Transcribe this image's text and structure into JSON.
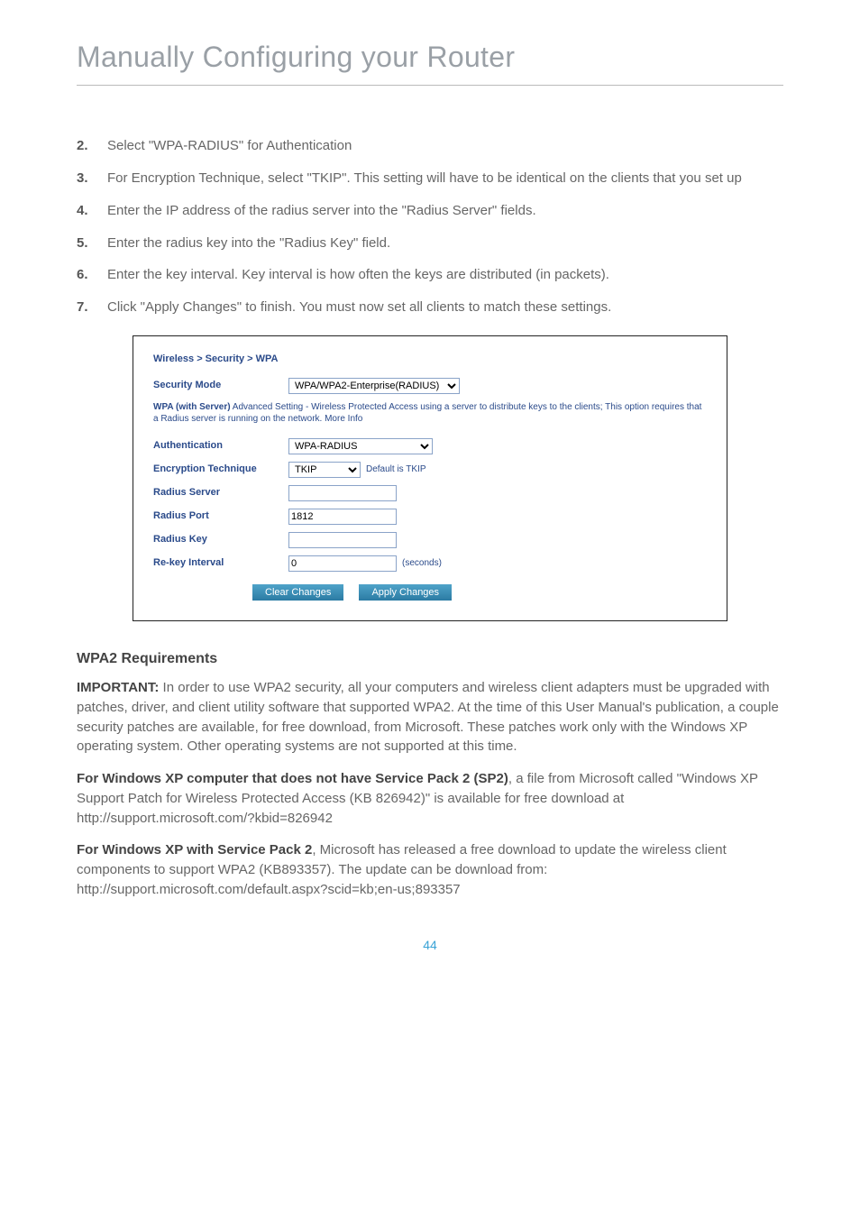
{
  "title": "Manually Configuring your Router",
  "steps": [
    {
      "num": "2.",
      "txt": "Select \"WPA-RADIUS\" for Authentication"
    },
    {
      "num": "3.",
      "txt": "For Encryption Technique, select \"TKIP\". This setting will have to be identical on the clients that you set up"
    },
    {
      "num": "4.",
      "txt": "Enter the IP address of the radius server into the \"Radius Server\" fields."
    },
    {
      "num": "5.",
      "txt": "Enter the radius key into the \"Radius Key\" field."
    },
    {
      "num": "6.",
      "txt": "Enter the key interval. Key interval is how often the keys are distributed (in packets)."
    },
    {
      "num": "7.",
      "txt": "Click \"Apply Changes\" to finish. You must now set all clients to match these settings."
    }
  ],
  "panel": {
    "breadcrumb": "Wireless > Security > WPA",
    "security_mode_label": "Security Mode",
    "security_mode_value": "WPA/WPA2-Enterprise(RADIUS)",
    "desc_bold": "WPA (with Server)",
    "desc_rest": " Advanced Setting - Wireless Protected Access using a server to distribute keys to the clients; This option requires that a Radius server is running on the network. More Info",
    "auth_label": "Authentication",
    "auth_value": "WPA-RADIUS",
    "enc_label": "Encryption Technique",
    "enc_value": "TKIP",
    "enc_hint": "Default is TKIP",
    "radius_server_label": "Radius Server",
    "radius_server_value": "",
    "radius_port_label": "Radius Port",
    "radius_port_value": "1812",
    "radius_key_label": "Radius Key",
    "radius_key_value": "",
    "rekey_label": "Re-key Interval",
    "rekey_value": "0",
    "rekey_hint": "(seconds)",
    "clear_btn": "Clear Changes",
    "apply_btn": "Apply Changes"
  },
  "wpa2_heading": "WPA2 Requirements",
  "wpa2_para_lead": "IMPORTANT:",
  "wpa2_para_body": " In order to use WPA2 security, all your computers and wireless client adapters must be upgraded with patches, driver, and client utility software that supported WPA2. At the time of this User Manual's publication, a couple security patches are available, for free download, from Microsoft. These patches work only with the Windows XP operating system. Other operating systems are not supported at this time.",
  "sp2_lead": "For Windows XP computer that does not have Service Pack 2 (SP2)",
  "sp2_body": ", a file from Microsoft called \"Windows XP Support Patch for Wireless Protected Access (KB 826942)\" is available for free download at http://support.microsoft.com/?kbid=826942",
  "sp2b_lead": "For Windows XP with Service Pack 2",
  "sp2b_body": ", Microsoft has released a free download to update the wireless client components to support WPA2 (KB893357). The update can be download from:  http://support.microsoft.com/default.aspx?scid=kb;en-us;893357",
  "page_number": "44"
}
